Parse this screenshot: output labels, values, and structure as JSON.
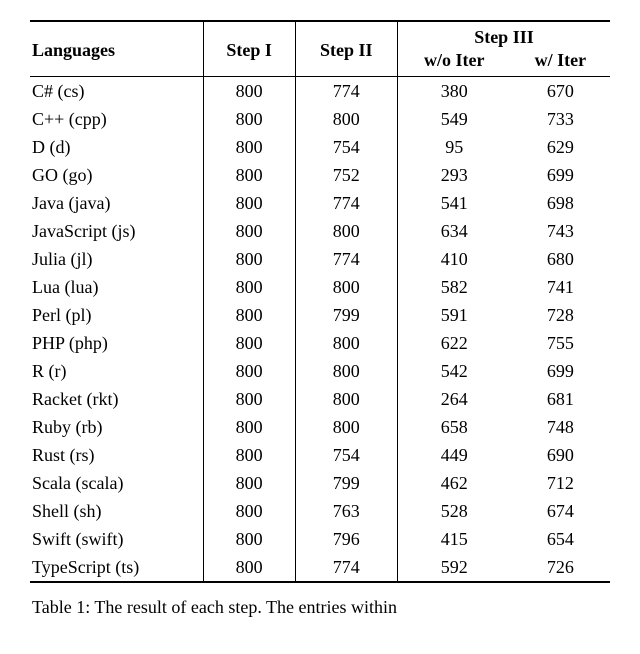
{
  "chart_data": {
    "type": "table",
    "title": "Table 1",
    "columns": [
      "Languages",
      "Step I",
      "Step II",
      "Step III w/o Iter",
      "Step III w/ Iter"
    ],
    "rows": [
      [
        "C# (cs)",
        800,
        774,
        380,
        670
      ],
      [
        "C++ (cpp)",
        800,
        800,
        549,
        733
      ],
      [
        "D (d)",
        800,
        754,
        95,
        629
      ],
      [
        "GO (go)",
        800,
        752,
        293,
        699
      ],
      [
        "Java (java)",
        800,
        774,
        541,
        698
      ],
      [
        "JavaScript (js)",
        800,
        800,
        634,
        743
      ],
      [
        "Julia (jl)",
        800,
        774,
        410,
        680
      ],
      [
        "Lua (lua)",
        800,
        800,
        582,
        741
      ],
      [
        "Perl (pl)",
        800,
        799,
        591,
        728
      ],
      [
        "PHP (php)",
        800,
        800,
        622,
        755
      ],
      [
        "R (r)",
        800,
        800,
        542,
        699
      ],
      [
        "Racket (rkt)",
        800,
        800,
        264,
        681
      ],
      [
        "Ruby (rb)",
        800,
        800,
        658,
        748
      ],
      [
        "Rust (rs)",
        800,
        754,
        449,
        690
      ],
      [
        "Scala (scala)",
        800,
        799,
        462,
        712
      ],
      [
        "Shell (sh)",
        800,
        763,
        528,
        674
      ],
      [
        "Swift (swift)",
        800,
        796,
        415,
        654
      ],
      [
        "TypeScript (ts)",
        800,
        774,
        592,
        726
      ]
    ]
  },
  "headers": {
    "languages": "Languages",
    "step1": "Step I",
    "step2": "Step II",
    "step3": "Step III",
    "wo_iter": "w/o Iter",
    "w_iter": "w/ Iter"
  },
  "rows": [
    {
      "lang": "C# (cs)",
      "s1": "800",
      "s2": "774",
      "wo": "380",
      "w": "670"
    },
    {
      "lang": "C++ (cpp)",
      "s1": "800",
      "s2": "800",
      "wo": "549",
      "w": "733"
    },
    {
      "lang": "D (d)",
      "s1": "800",
      "s2": "754",
      "wo": "95",
      "w": "629"
    },
    {
      "lang": "GO (go)",
      "s1": "800",
      "s2": "752",
      "wo": "293",
      "w": "699"
    },
    {
      "lang": "Java (java)",
      "s1": "800",
      "s2": "774",
      "wo": "541",
      "w": "698"
    },
    {
      "lang": "JavaScript (js)",
      "s1": "800",
      "s2": "800",
      "wo": "634",
      "w": "743"
    },
    {
      "lang": "Julia (jl)",
      "s1": "800",
      "s2": "774",
      "wo": "410",
      "w": "680"
    },
    {
      "lang": "Lua (lua)",
      "s1": "800",
      "s2": "800",
      "wo": "582",
      "w": "741"
    },
    {
      "lang": "Perl (pl)",
      "s1": "800",
      "s2": "799",
      "wo": "591",
      "w": "728"
    },
    {
      "lang": "PHP (php)",
      "s1": "800",
      "s2": "800",
      "wo": "622",
      "w": "755"
    },
    {
      "lang": "R (r)",
      "s1": "800",
      "s2": "800",
      "wo": "542",
      "w": "699"
    },
    {
      "lang": "Racket (rkt)",
      "s1": "800",
      "s2": "800",
      "wo": "264",
      "w": "681"
    },
    {
      "lang": "Ruby (rb)",
      "s1": "800",
      "s2": "800",
      "wo": "658",
      "w": "748"
    },
    {
      "lang": "Rust (rs)",
      "s1": "800",
      "s2": "754",
      "wo": "449",
      "w": "690"
    },
    {
      "lang": "Scala (scala)",
      "s1": "800",
      "s2": "799",
      "wo": "462",
      "w": "712"
    },
    {
      "lang": "Shell (sh)",
      "s1": "800",
      "s2": "763",
      "wo": "528",
      "w": "674"
    },
    {
      "lang": "Swift (swift)",
      "s1": "800",
      "s2": "796",
      "wo": "415",
      "w": "654"
    },
    {
      "lang": "TypeScript (ts)",
      "s1": "800",
      "s2": "774",
      "wo": "592",
      "w": "726"
    }
  ],
  "caption": {
    "label": "Table 1:",
    "text_partial": "The result of each step. The entries within"
  }
}
